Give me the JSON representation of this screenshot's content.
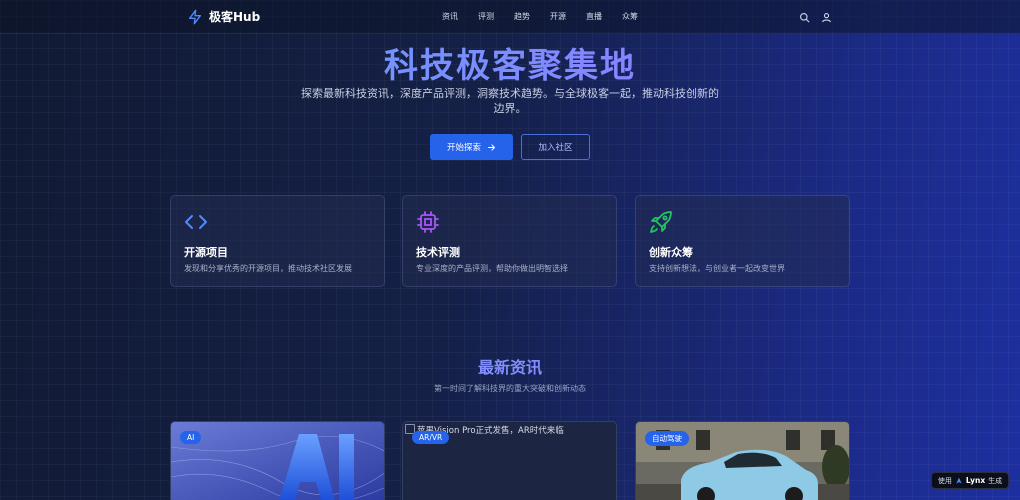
{
  "nav": {
    "logo_text": "极客Hub",
    "links": [
      "资讯",
      "评测",
      "趋势",
      "开源",
      "直播",
      "众筹"
    ],
    "icons": [
      "search-icon",
      "user-icon"
    ]
  },
  "hero": {
    "title": "科技极客聚集地",
    "subtitle": "探索最新科技资讯，深度产品评测，洞察技术趋势。与全球极客一起，推动科技创新的边界。",
    "primary_button": "开始探索",
    "secondary_button": "加入社区"
  },
  "features": [
    {
      "title": "开源项目",
      "desc": "发现和分享优秀的开源项目，推动技术社区发展",
      "icon": "code-icon",
      "color": "#4f8bff"
    },
    {
      "title": "技术评测",
      "desc": "专业深度的产品评测，帮助你做出明智选择",
      "icon": "cpu-chip-icon",
      "color": "#a855f7"
    },
    {
      "title": "创新众筹",
      "desc": "支持创新想法，与创业者一起改变世界",
      "icon": "rocket-icon",
      "color": "#22c55e"
    }
  ],
  "news": {
    "title": "最新资讯",
    "subtitle": "第一时间了解科技界的重大突破和创新动态",
    "cards": [
      {
        "tag": "AI",
        "image_alt": ""
      },
      {
        "tag": "AR/VR",
        "image_alt": "苹果Vision Pro正式发售，AR时代来临"
      },
      {
        "tag": "自动驾驶",
        "image_alt": ""
      }
    ]
  },
  "badge": {
    "prefix": "使用",
    "brand": "Lynx",
    "suffix": "生成"
  },
  "colors": {
    "accent": "#2563eb",
    "title_gradient_start": "#5aa6ff",
    "title_gradient_end": "#a66cff"
  }
}
